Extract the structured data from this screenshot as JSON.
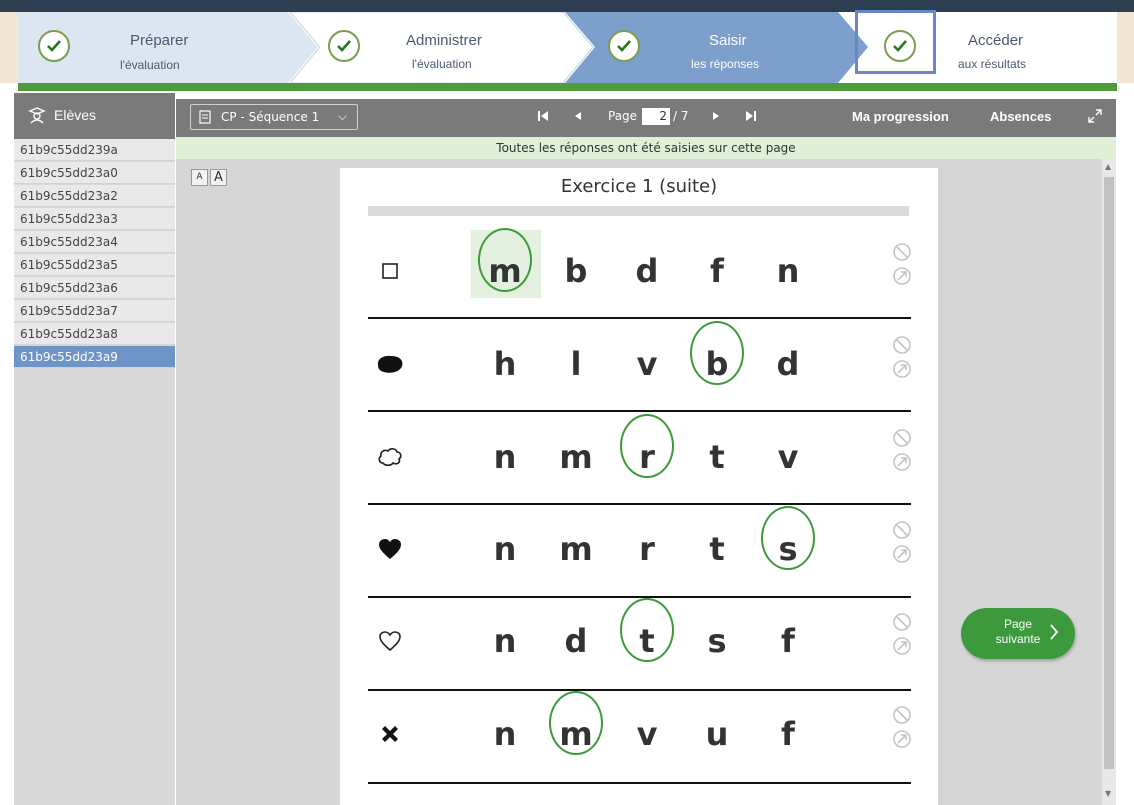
{
  "steps": [
    {
      "line1": "Préparer",
      "line2": "l'évaluation",
      "state": "done"
    },
    {
      "line1": "Administrer",
      "line2": "l'évaluation",
      "state": "done"
    },
    {
      "line1": "Saisir",
      "line2": "les réponses",
      "state": "current"
    },
    {
      "line1": "Accéder",
      "line2": "aux résultats",
      "state": "done"
    }
  ],
  "sidebar": {
    "title": "Elèves",
    "students": [
      "61b9c55dd239a",
      "61b9c55dd23a0",
      "61b9c55dd23a2",
      "61b9c55dd23a3",
      "61b9c55dd23a4",
      "61b9c55dd23a5",
      "61b9c55dd23a6",
      "61b9c55dd23a7",
      "61b9c55dd23a8",
      "61b9c55dd23a9"
    ],
    "selected_index": 9
  },
  "toolbar": {
    "sequence": "CP - Séquence 1",
    "page_label": "Page",
    "page_current": "2",
    "page_total": "/ 7",
    "progress_label": "Ma progression",
    "absences_label": "Absences"
  },
  "notice": "Toutes les réponses ont été saisies sur cette page",
  "font_buttons": [
    "A",
    "A"
  ],
  "exercise": {
    "title": "Exercice 1 (suite)",
    "rows": [
      {
        "symbol": "square",
        "letters": [
          "m",
          "b",
          "d",
          "f",
          "n"
        ],
        "circled": 0,
        "highlighted": 0
      },
      {
        "symbol": "blob",
        "letters": [
          "h",
          "l",
          "v",
          "b",
          "d"
        ],
        "circled": 3,
        "highlighted": null
      },
      {
        "symbol": "cloud",
        "letters": [
          "n",
          "m",
          "r",
          "t",
          "v"
        ],
        "circled": 2,
        "highlighted": null
      },
      {
        "symbol": "heart-filled",
        "letters": [
          "n",
          "m",
          "r",
          "t",
          "s"
        ],
        "circled": 4,
        "highlighted": null
      },
      {
        "symbol": "heart-outline",
        "letters": [
          "n",
          "d",
          "t",
          "s",
          "f"
        ],
        "circled": 2,
        "highlighted": null
      },
      {
        "symbol": "cross",
        "letters": [
          "n",
          "m",
          "v",
          "u",
          "f"
        ],
        "circled": 1,
        "highlighted": null
      }
    ]
  },
  "next_button": {
    "line1": "Page",
    "line2": "suivante"
  },
  "colors": {
    "accent_green": "#3c9a3c",
    "selection_blue": "#6f95c8",
    "step_current": "#7d9fcb"
  }
}
